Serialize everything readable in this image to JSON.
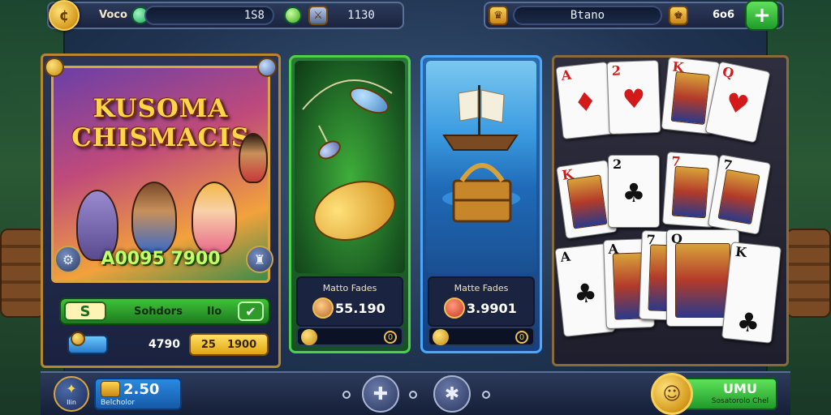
{
  "topbar": {
    "left_label": "Voco",
    "balance": "1S8",
    "gems": "1130",
    "right_label": "Btano",
    "right_value": "6o6"
  },
  "featured": {
    "title_line1": "KUSOMA",
    "title_line2": "CHISMACIS",
    "jackpot": "A0095 7900",
    "bet_label": "S",
    "bet_text_left": "Sohdors",
    "bet_text_right": "Ilo",
    "stat_left": "4790",
    "stat_mid": "25",
    "stat_right": "1900"
  },
  "fishing_card": {
    "title": "Matto Fades",
    "value": "55.190",
    "footer_badge": "0"
  },
  "ship_card": {
    "title": "Matte Fades",
    "value": "3.9901",
    "footer_badge": "0"
  },
  "bottombar": {
    "badge_label": "Ilin",
    "blue_value": "2.50",
    "blue_sub": "Belcholor",
    "green_value": "UMU",
    "green_sub": "Sosatorolo Chel"
  },
  "colors": {
    "gold": "#f8d05a",
    "green_accent": "#4ed14a",
    "blue_accent": "#4aa8ff"
  },
  "icons": [
    "coin-icon",
    "gem-icon",
    "sword-icon",
    "trophy-icon",
    "plus-icon",
    "check-icon",
    "star-icon",
    "puzzle-icon"
  ]
}
